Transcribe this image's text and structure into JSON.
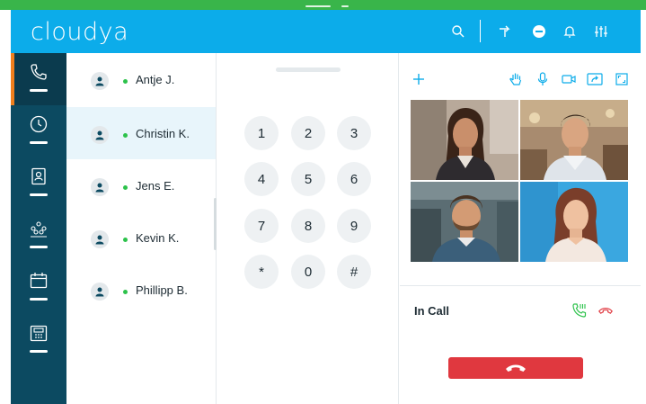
{
  "app": {
    "title": "cloudya",
    "accent_color": "#0cacea",
    "top_bar_color": "#39b54a",
    "sidebar_color": "#0c4a61"
  },
  "header": {
    "icons": [
      "search-icon",
      "call-forward-icon",
      "do-not-disturb-icon",
      "bell-icon",
      "settings-sliders-icon"
    ]
  },
  "sidebar": {
    "items": [
      {
        "icon": "phone-icon",
        "active": true
      },
      {
        "icon": "clock-history-icon",
        "active": false
      },
      {
        "icon": "contact-card-icon",
        "active": false
      },
      {
        "icon": "group-conference-icon",
        "active": false
      },
      {
        "icon": "calendar-icon",
        "active": false
      },
      {
        "icon": "fax-icon",
        "active": false
      }
    ]
  },
  "contacts": [
    {
      "name": "Antje J.",
      "status": "online"
    },
    {
      "name": "Christin K.",
      "status": "online",
      "selected": true
    },
    {
      "name": "Jens E.",
      "status": "online"
    },
    {
      "name": "Kevin K.",
      "status": "online"
    },
    {
      "name": "Phillipp B.",
      "status": "online"
    }
  ],
  "dialpad": {
    "keys": [
      "1",
      "2",
      "3",
      "4",
      "5",
      "6",
      "7",
      "8",
      "9",
      "*",
      "0",
      "#"
    ]
  },
  "call": {
    "toolbar_icons": [
      "add-icon",
      "raise-hand-icon",
      "microphone-icon",
      "video-camera-icon",
      "screen-share-icon",
      "fullscreen-icon"
    ],
    "participants": [
      "participant-1",
      "participant-2",
      "participant-3",
      "participant-4"
    ],
    "status_label": "In Call",
    "hangup_color": "#e0383f"
  }
}
